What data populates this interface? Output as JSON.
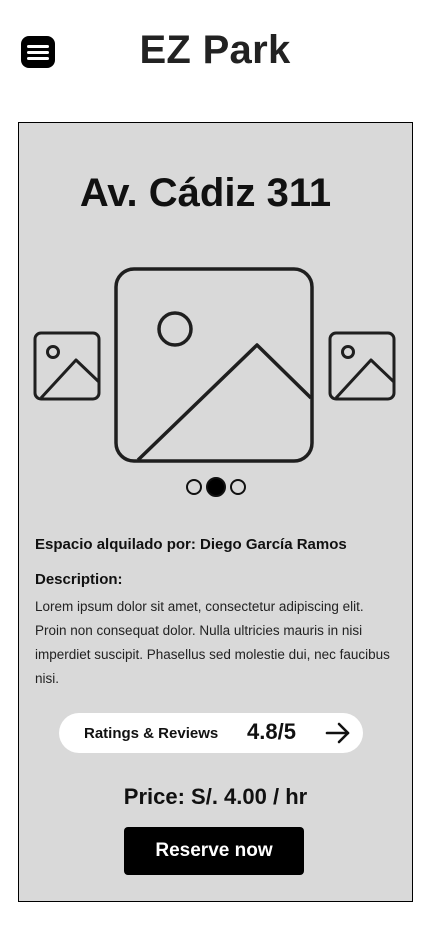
{
  "header": {
    "menu_icon": "hamburger-menu-icon",
    "title": "EZ Park"
  },
  "listing": {
    "address": "Av. Cádiz 311",
    "gallery": {
      "images": [
        "image-placeholder-icon",
        "image-placeholder-icon",
        "image-placeholder-icon"
      ],
      "active_index": 1,
      "total": 3
    },
    "owner_text": "Espacio alquilado por: Diego García Ramos",
    "description_label": "Description:",
    "description_text": "Lorem ipsum dolor sit amet, consectetur adipiscing elit. Proin non consequat dolor. Nulla ultricies mauris in nisi imperdiet suscipit. Phasellus sed molestie dui, nec faucibus nisi.",
    "ratings_label": "Ratings & Reviews",
    "ratings_value": "4.8/5",
    "ratings_icon": "arrow-right-icon",
    "price": "Price: S/. 4.00 / hr",
    "reserve_label": "Reserve now"
  },
  "colors": {
    "card_background": "#d9d9d9",
    "primary": "#000000",
    "pill_background": "#ffffff"
  }
}
